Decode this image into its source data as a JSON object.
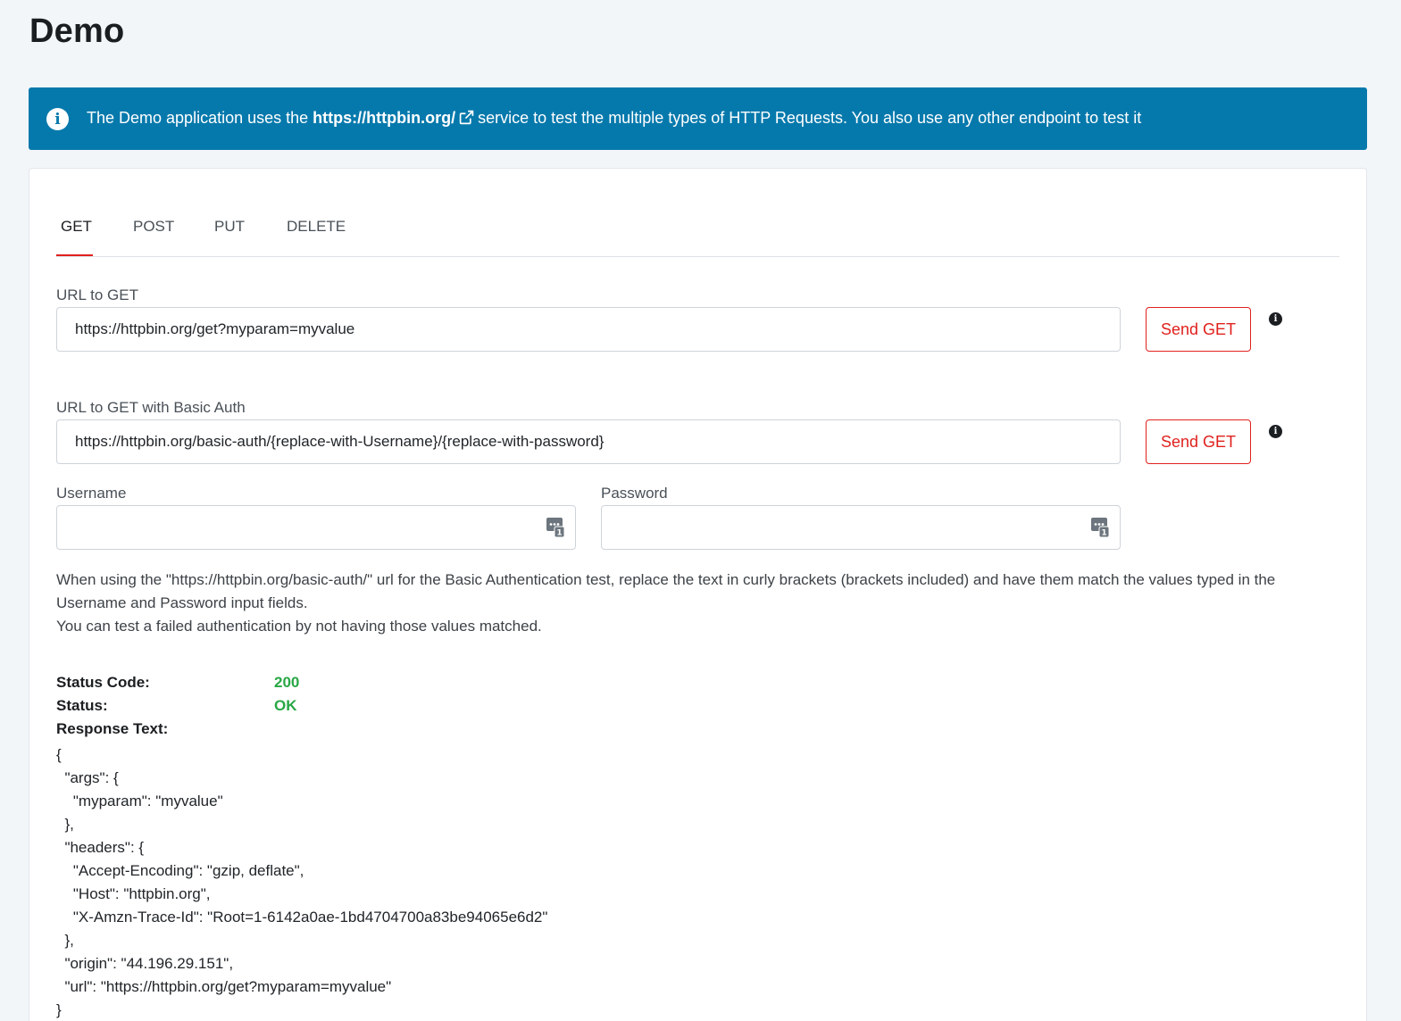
{
  "page": {
    "title": "Demo"
  },
  "alert": {
    "text_before": "The Demo application uses the",
    "link": "https://httpbin.org/",
    "text_after": "service to test the multiple types of HTTP Requests. You also use any other endpoint to test it",
    "icon": "info-circle-icon",
    "color": "#0679ac"
  },
  "tabs": [
    {
      "label": "GET",
      "active": true
    },
    {
      "label": "POST",
      "active": false
    },
    {
      "label": "PUT",
      "active": false
    },
    {
      "label": "DELETE",
      "active": false
    }
  ],
  "get_form": {
    "label": "URL to GET",
    "value": "https://httpbin.org/get?myparam=myvalue",
    "button": "Send GET"
  },
  "auth_form": {
    "label": "URL to GET with Basic Auth",
    "value": "https://httpbin.org/basic-auth/{replace-with-Username}/{replace-with-password}",
    "button": "Send GET",
    "username_label": "Username",
    "username_value": "",
    "password_label": "Password",
    "password_value": ""
  },
  "help_text": {
    "line1": "When using the \"https://httpbin.org/basic-auth/\" url for the Basic Authentication test, replace the text in curly brackets (brackets included) and have them match the values typed in the Username and Password input fields.",
    "line2": "You can test a failed authentication by not having those values matched."
  },
  "response": {
    "status_code_label": "Status Code:",
    "status_code": "200",
    "status_label": "Status:",
    "status": "OK",
    "response_text_label": "Response Text:",
    "body": "{\n  \"args\": {\n    \"myparam\": \"myvalue\"\n  },\n  \"headers\": {\n    \"Accept-Encoding\": \"gzip, deflate\",\n    \"Host\": \"httpbin.org\",\n    \"X-Amzn-Trace-Id\": \"Root=1-6142a0ae-1bd4704700a83be94065e6d2\"\n  },\n  \"origin\": \"44.196.29.151\",\n  \"url\": \"https://httpbin.org/get?myparam=myvalue\"\n}"
  },
  "colors": {
    "accent_red": "#e0211d",
    "success_green": "#28a745",
    "info_blue": "#0679ac"
  }
}
